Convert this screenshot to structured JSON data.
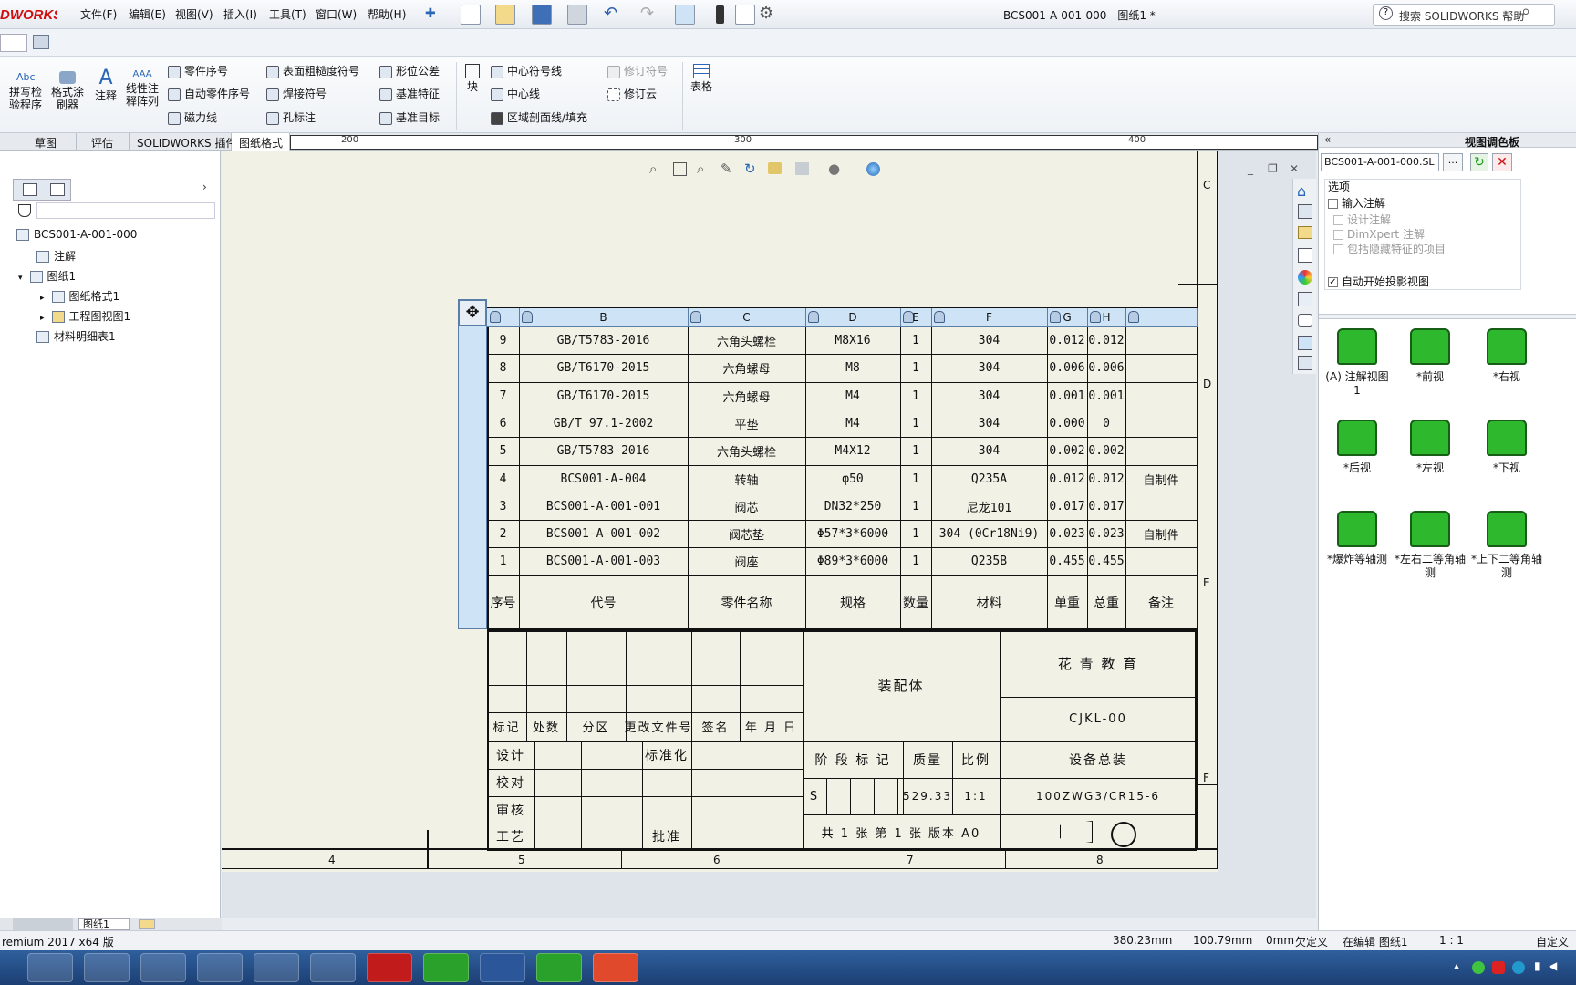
{
  "app": {
    "logo_text": "DWORKS",
    "title": "BCS001-A-001-000 - 图纸1 *"
  },
  "menu": [
    "文件(F)",
    "编辑(E)",
    "视图(V)",
    "插入(I)",
    "工具(T)",
    "窗口(W)",
    "帮助(H)"
  ],
  "search": {
    "placeholder": "搜索 SOLIDWORKS 帮助"
  },
  "ribbon": {
    "spell_check": "拼写检\n验程序",
    "format_painter": "格式涂\n刷器",
    "note": "注释",
    "linear_note": "线性注\n释阵列",
    "balloon": "零件序号",
    "auto_balloon": "自动零件序号",
    "magnetic_line": "磁力线",
    "surface_finish": "表面粗糙度符号",
    "weld_symbol": "焊接符号",
    "hole_callout": "孔标注",
    "gtol": "形位公差",
    "datum_feature": "基准特征",
    "datum_target": "基准目标",
    "block": "块",
    "centermark": "中心符号线",
    "centerline": "中心线",
    "hatch": "区域剖面线/填充",
    "revision_symbol": "修订符号",
    "revision_cloud": "修订云",
    "table": "表格"
  },
  "tabs": [
    "草图",
    "评估",
    "SOLIDWORKS 插件",
    "图纸格式"
  ],
  "ruler": {
    "labels": [
      "200",
      "300",
      "400"
    ]
  },
  "tree": {
    "root": "BCS001-A-001-000",
    "annotations": "注解",
    "sheet": "图纸1",
    "sheet_format": "图纸格式1",
    "drawing_view": "工程图视图1",
    "bom": "材料明细表1"
  },
  "bom": {
    "col_letters": [
      "B",
      "C",
      "D",
      "E",
      "F",
      "G",
      "H"
    ],
    "rows": [
      [
        "9",
        "GB/T5783-2016",
        "六角头螺栓",
        "M8X16",
        "1",
        "304",
        "0.012",
        "0.012",
        ""
      ],
      [
        "8",
        "GB/T6170-2015",
        "六角螺母",
        "M8",
        "1",
        "304",
        "0.006",
        "0.006",
        ""
      ],
      [
        "7",
        "GB/T6170-2015",
        "六角螺母",
        "M4",
        "1",
        "304",
        "0.001",
        "0.001",
        ""
      ],
      [
        "6",
        "GB/T 97.1-2002",
        "平垫",
        "M4",
        "1",
        "304",
        "0.000",
        "0",
        ""
      ],
      [
        "5",
        "GB/T5783-2016",
        "六角头螺栓",
        "M4X12",
        "1",
        "304",
        "0.002",
        "0.002",
        ""
      ],
      [
        "4",
        "BCS001-A-004",
        "转轴",
        "φ50",
        "1",
        "Q235A",
        "0.012",
        "0.012",
        "自制件"
      ],
      [
        "3",
        "BCS001-A-001-001",
        "阀芯",
        "DN32*250",
        "1",
        "尼龙101",
        "0.017",
        "0.017",
        ""
      ],
      [
        "2",
        "BCS001-A-001-002",
        "阀芯垫",
        "Φ57*3*6000",
        "1",
        "304 (0Cr18Ni9)",
        "0.023",
        "0.023",
        "自制件"
      ],
      [
        "1",
        "BCS001-A-001-003",
        "阀座",
        "Φ89*3*6000",
        "1",
        "Q235B",
        "0.455",
        "0.455",
        ""
      ]
    ],
    "header": [
      "序号",
      "代号",
      "零件名称",
      "规格",
      "数量",
      "材料",
      "单重",
      "总重",
      "备注"
    ]
  },
  "title_block": {
    "mark_labels": [
      "标记",
      "处数",
      "分区",
      "更改文件号",
      "签名",
      "年 月 日"
    ],
    "role_labels": [
      "设计",
      "校对",
      "审核",
      "工艺"
    ],
    "standardization": "标准化",
    "approval": "批准",
    "assembly": "装配体",
    "company": "花 青 教 育",
    "drawing_no": "CJKL-00",
    "stage_mark": "阶 段 标 记",
    "mass_label": "质量",
    "scale_label": "比例",
    "stage_value": "S",
    "mass_value": "529.33",
    "scale_value": "1:1",
    "name": "设备总装",
    "model": "100ZWG3/CR15-6",
    "sheets": "共 1 张  第 1 张  版本 A0"
  },
  "zone_numbers": [
    "4",
    "5",
    "6",
    "7",
    "8"
  ],
  "zone_letters": [
    "C",
    "D",
    "E",
    "F"
  ],
  "right_panel": {
    "title": "视图调色板",
    "file_dropdown": "BCS001-A-001-000.SL",
    "browse": "...",
    "options_label": "选项",
    "import_annotations": "输入注解",
    "design_annotations": "设计注解",
    "dimxpert": "DimXpert 注解",
    "hidden_features": "包括隐藏特征的项目",
    "auto_projected": "自动开始投影视图",
    "views": [
      "(A) 注解视图\n1",
      "*前视",
      "*右视",
      "*后视",
      "*左视",
      "*下视",
      "*爆炸等轴测",
      "*左右二等角轴\n测",
      "*上下二等角轴\n测"
    ]
  },
  "status": {
    "version": "remium 2017 x64 版",
    "x": "380.23mm",
    "y": "100.79mm",
    "z": "0mm",
    "defined": "欠定义",
    "editing": "在编辑 图纸1",
    "scale": "1 : 1",
    "custom": "自定义",
    "sheet_tab": "图纸1"
  },
  "colors": {
    "accent": "#cfe3f7",
    "sheet": "#f1f1e6",
    "taskbar": "#1f4577"
  }
}
